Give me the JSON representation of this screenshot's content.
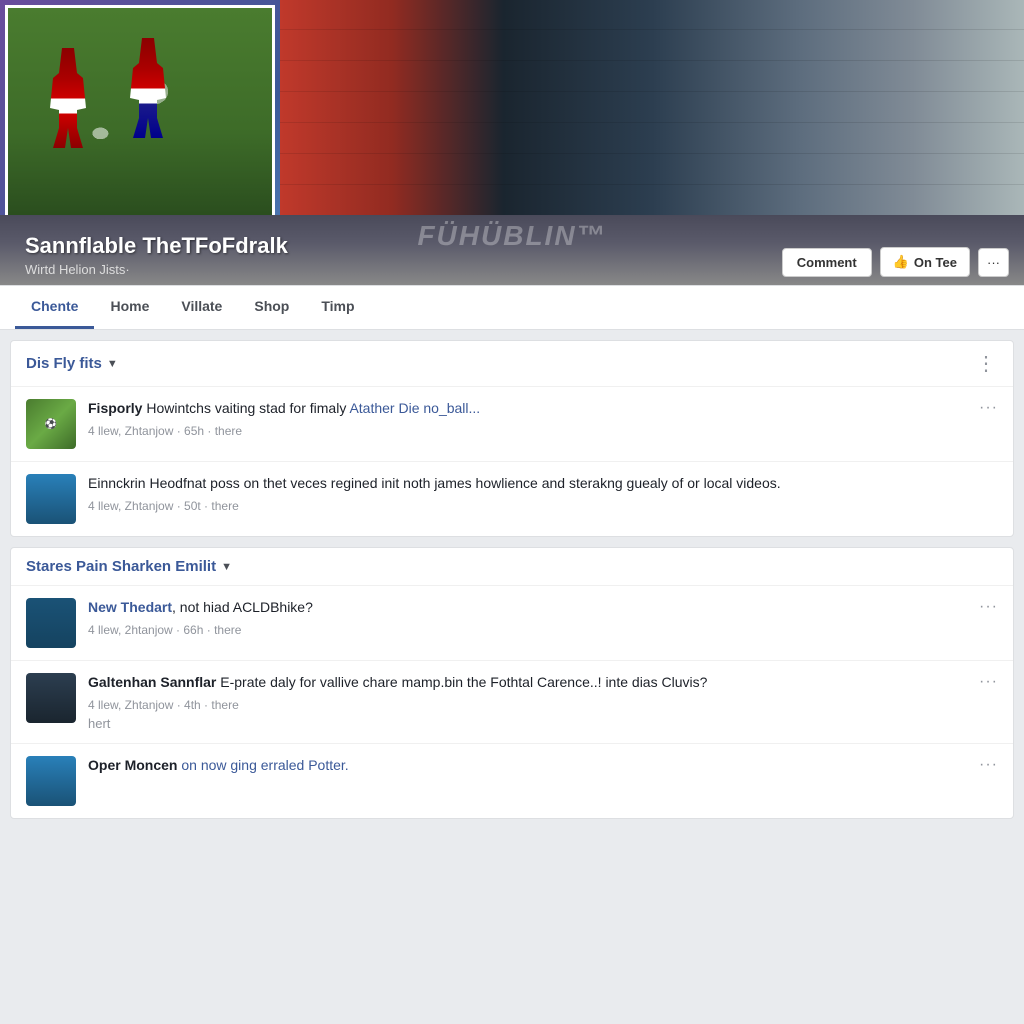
{
  "header": {
    "brand_overlay": "FÜHÜBLIN™",
    "profile_name": "Sannflable TheTFoFdralk",
    "profile_subtitle": "Wirtd Helion Jists·",
    "btn_comment": "Comment",
    "btn_like": "On Tee",
    "btn_more": "···"
  },
  "nav": {
    "tabs": [
      {
        "label": "Chente",
        "active": true
      },
      {
        "label": "Home",
        "active": false
      },
      {
        "label": "Villate",
        "active": false
      },
      {
        "label": "Shop",
        "active": false
      },
      {
        "label": "Timp",
        "active": false
      }
    ]
  },
  "sections": [
    {
      "id": "section1",
      "title": "Dis Fly fits",
      "posts": [
        {
          "id": "post1",
          "avatar_type": "soccer",
          "author": "Fisporly",
          "text": " Howintchs vaiting stad for fimaly ",
          "link": "Atather Die no_ball...",
          "meta": "4 llew, Zhtanjow · 65h · there",
          "has_menu": true
        },
        {
          "id": "post2",
          "avatar_type": "person1",
          "author": "",
          "text": "Einnckrin Heodfnat poss on thet veces regined init noth james howlience and sterakng guealy of or local videos.",
          "link": "",
          "meta": "4 llew, Zhtanjow · 50t · there",
          "has_menu": false
        }
      ]
    },
    {
      "id": "section2",
      "title": "Stares Pain Sharken Emilit",
      "posts": [
        {
          "id": "post3",
          "avatar_type": "person2",
          "author": "New Thedart",
          "text": ", not hiad ACLDBhike?",
          "link": "",
          "meta": "4 llew, 2htanjow · 66h · there",
          "has_menu": true
        },
        {
          "id": "post4",
          "avatar_type": "person3",
          "author": "Galtenhan",
          "author2": " Sannflar",
          "text": " E-prate daly for vallive chare mamp.bin the Fothtal Carence..! inte dias Cluvis?",
          "link": "",
          "meta": "4 llew, Zhtanjow · 4th · there",
          "reply": "hert",
          "has_menu": true
        },
        {
          "id": "post5",
          "avatar_type": "person4",
          "author": "Oper Moncen",
          "text": " on now ging erraled Potter.",
          "link": "",
          "meta": "",
          "has_menu": true
        }
      ]
    }
  ]
}
